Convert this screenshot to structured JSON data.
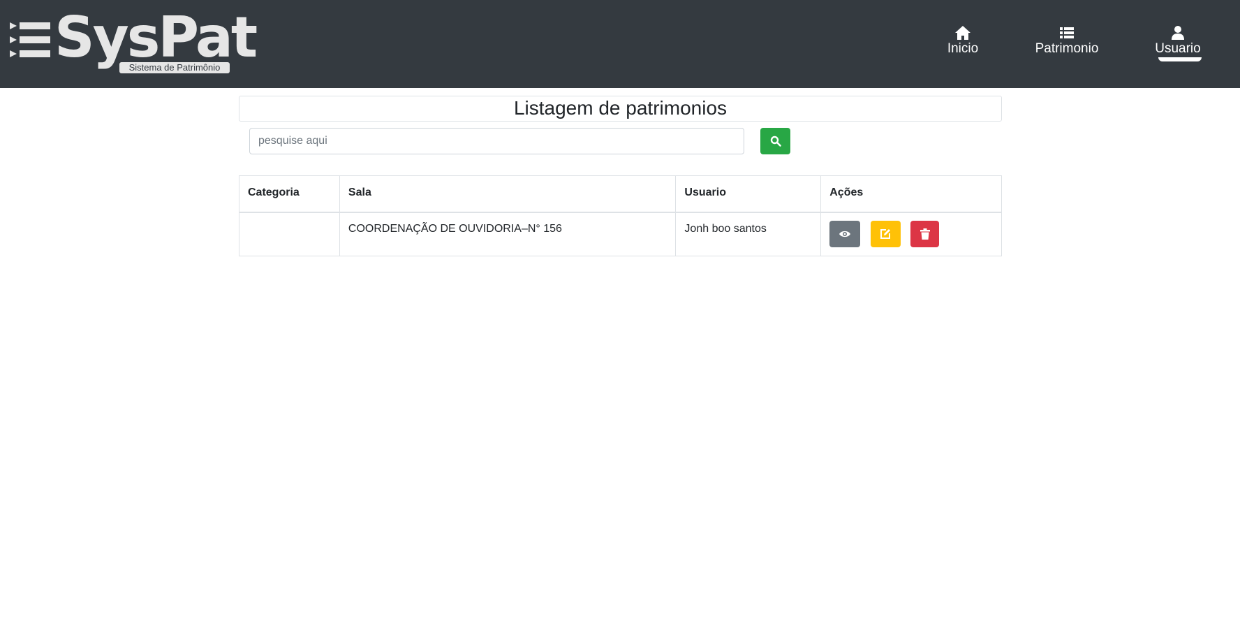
{
  "brand": {
    "name": "SysPat",
    "subtitle": "Sistema de Patrimônio",
    "icon": "list-logo-icon",
    "color": "#343a40"
  },
  "nav": {
    "items": [
      {
        "label": "Inicio",
        "icon": "home-icon"
      },
      {
        "label": "Patrimonio",
        "icon": "list-icon"
      },
      {
        "label": "Usuario",
        "icon": "user-icon",
        "active": true
      }
    ]
  },
  "page": {
    "title": "Listagem de patrimonios"
  },
  "search": {
    "placeholder": "pesquise aqui",
    "value": "",
    "button_icon": "search-icon",
    "button_color": "#28a745"
  },
  "table": {
    "headers": [
      "Categoria",
      "Sala",
      "Usuario",
      "Ações"
    ],
    "rows": [
      {
        "categoria": "",
        "sala": "COORDENAÇÃO DE OUVIDORIA–N° 156",
        "usuario": "Jonh boo santos",
        "actions": [
          {
            "icon": "eye-icon",
            "color": "#6c757d"
          },
          {
            "icon": "edit-icon",
            "color": "#ffc107"
          },
          {
            "icon": "trash-icon",
            "color": "#dc3545"
          }
        ]
      }
    ]
  }
}
